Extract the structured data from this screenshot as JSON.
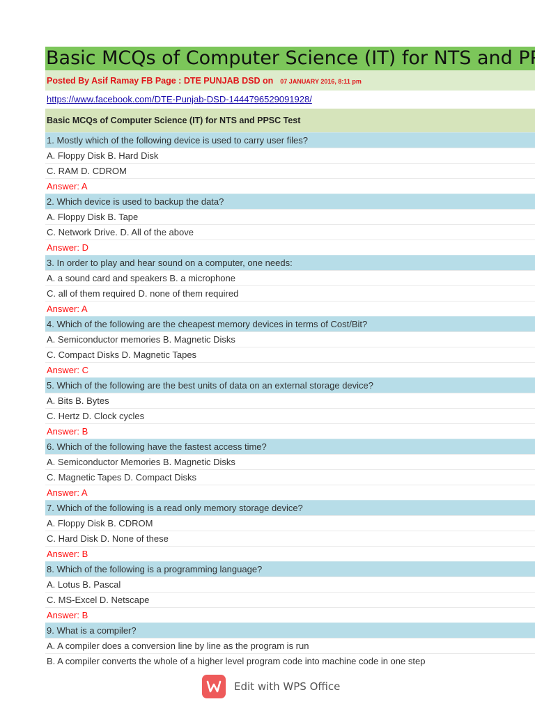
{
  "header": {
    "title": "Basic MCQs of Computer Science (IT) for NTS and PPSC Test",
    "posted_by": "Posted By Asif Ramay  FB Page : DTE PUNJAB DSD on",
    "posted_date": "07 JANUARY 2016, 8:11 pm",
    "link": "https://www.facebook.com/DTE-Punjab-DSD-1444796529091928/",
    "subtitle": "Basic MCQs of Computer Science (IT) for NTS and PPSC  Test"
  },
  "questions": [
    {
      "q": "1. Mostly which of the following device is used to carry user files?",
      "opt1": "A. Floppy Disk B. Hard Disk",
      "opt2": "C. RAM D. CDROM",
      "answer": "Answer: A"
    },
    {
      "q": "2. Which device is used to backup the data?",
      "opt1": "A. Floppy Disk B. Tape",
      "opt2": "C. Network Drive. D. All of the above",
      "answer": "Answer: D"
    },
    {
      "q": "3. In order to play and hear sound on a computer, one needs:",
      "opt1": "A. a sound card and speakers B. a microphone",
      "opt2": "C. all of them required D. none of them required",
      "answer": "Answer: A"
    },
    {
      "q": "4. Which of the following are the cheapest memory devices in terms of Cost/Bit?",
      "opt1": "A. Semiconductor memories B. Magnetic Disks",
      "opt2": "C. Compact Disks D. Magnetic Tapes",
      "answer": "Answer: C"
    },
    {
      "q": "5. Which of the following are the best units of data on an external storage device?",
      "opt1": "A. Bits B. Bytes",
      "opt2": "C. Hertz D. Clock cycles",
      "answer": "Answer: B"
    },
    {
      "q": "6. Which of the following have the fastest access time?",
      "opt1": "A. Semiconductor Memories B. Magnetic Disks",
      "opt2": "C. Magnetic Tapes D. Compact Disks",
      "answer": "Answer: A"
    },
    {
      "q": "7. Which of the following is a read only memory storage device?",
      "opt1": "A. Floppy Disk B. CDROM",
      "opt2": "C. Hard Disk D. None of these",
      "answer": "Answer: B"
    },
    {
      "q": "8. Which of the following is a programming language?",
      "opt1": "A. Lotus B. Pascal",
      "opt2": "C. MS-Excel D. Netscape",
      "answer": "Answer: B"
    },
    {
      "q": "9. What is a compiler?",
      "opt1": "A. A compiler does a conversion line by line as the program is run",
      "opt2": "B. A compiler converts the whole of a higher level program code into machine code in one step"
    }
  ],
  "footer": {
    "logo_letter": "W",
    "label": "Edit with WPS Office"
  }
}
